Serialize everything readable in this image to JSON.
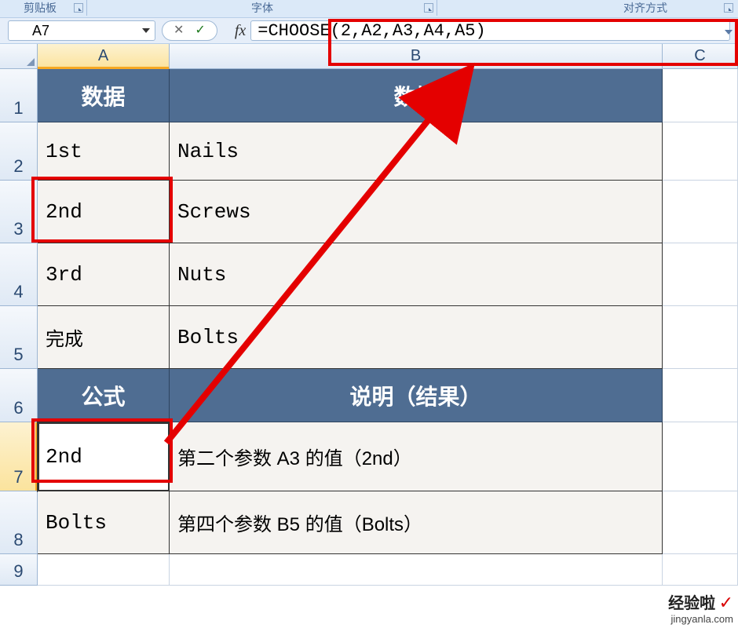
{
  "ribbon": {
    "group_clipboard": "剪贴板",
    "group_font": "字体",
    "group_align": "对齐方式"
  },
  "namebox": {
    "value": "A7"
  },
  "formula_bar": {
    "value": "=CHOOSE(2,A2,A3,A4,A5)"
  },
  "columns": {
    "A": "A",
    "B": "B",
    "C": "C"
  },
  "row_labels": [
    "1",
    "2",
    "3",
    "4",
    "5",
    "6",
    "7",
    "8",
    "9"
  ],
  "cells": {
    "r1": {
      "A": "数据",
      "B": "数据"
    },
    "r2": {
      "A": "1st",
      "B": "Nails"
    },
    "r3": {
      "A": "2nd",
      "B": "Screws"
    },
    "r4": {
      "A": "3rd",
      "B": "Nuts"
    },
    "r5": {
      "A": "完成",
      "B": "Bolts"
    },
    "r6": {
      "A": "公式",
      "B": "说明（结果）"
    },
    "r7": {
      "A": "2nd",
      "B": "第二个参数 A3 的值（2nd）"
    },
    "r8": {
      "A": "Bolts",
      "B": "第四个参数 B5 的值（Bolts）"
    }
  },
  "watermark": {
    "title": "经验啦",
    "url": "jingyanla.com"
  }
}
